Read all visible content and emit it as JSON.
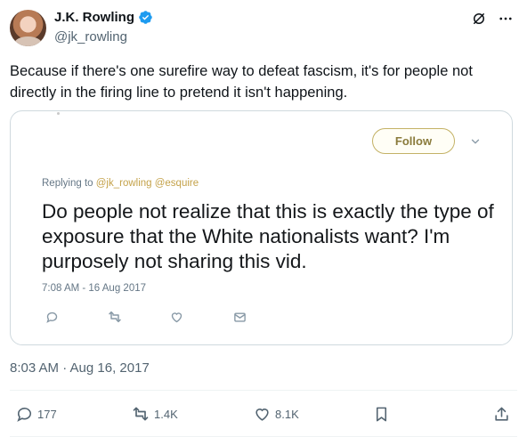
{
  "author": {
    "name": "J.K. Rowling",
    "handle": "@jk_rowling",
    "verified": true,
    "verified_color": "#1d9bf0"
  },
  "top_icons": [
    "grok-icon",
    "more-icon"
  ],
  "tweet": {
    "text": "Because if there's one surefire way to defeat fascism, it's for people not directly in the firing line to pretend it isn't happening.",
    "timestamp": "8:03 AM · Aug 16, 2017"
  },
  "embedded": {
    "follow_label": "Follow",
    "replying_prefix": "Replying to ",
    "replying_mentions": "@jk_rowling @esquire",
    "text": "Do people not realize that this is exactly the type of exposure that the White nationalists want? I'm purposely not sharing this vid.",
    "timestamp": "7:08 AM - 16 Aug 2017",
    "actions": [
      "reply-icon",
      "retweet-icon",
      "like-icon",
      "message-icon"
    ]
  },
  "actions": {
    "replies": "177",
    "reposts": "1.4K",
    "likes": "8.1K"
  },
  "colors": {
    "text": "#0f1419",
    "secondary": "#536471",
    "border": "#cfd9de",
    "follow_gold": "#c4b266"
  }
}
